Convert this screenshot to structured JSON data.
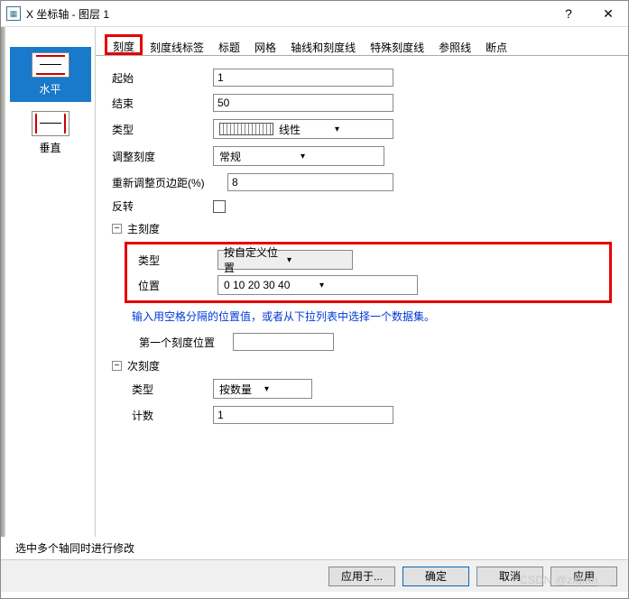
{
  "titlebar": {
    "title": "X 坐标轴 - 图层 1",
    "help": "?",
    "close": "✕"
  },
  "sidebar": {
    "items": [
      {
        "label": "水平",
        "selected": true
      },
      {
        "label": "垂直",
        "selected": false
      }
    ]
  },
  "tabs": {
    "items": [
      "刻度",
      "刻度线标签",
      "标题",
      "网格",
      "轴线和刻度线",
      "特殊刻度线",
      "参照线",
      "断点"
    ],
    "active": "刻度"
  },
  "fields": {
    "start_label": "起始",
    "start_value": "1",
    "end_label": "结束",
    "end_value": "50",
    "type_label": "类型",
    "type_value": "线性",
    "rescale_label": "调整刻度",
    "rescale_value": "常规",
    "margin_label": "重新调整页边距(%)",
    "margin_value": "8",
    "reverse_label": "反转",
    "major_group": "主刻度",
    "major_type_label": "类型",
    "major_type_value": "按自定义位置",
    "major_pos_label": "位置",
    "major_pos_value": "0 10 20 30 40",
    "info_text": "输入用空格分隔的位置值，或者从下拉列表中选择一个数据集。",
    "first_tick_label": "第一个刻度位置",
    "first_tick_value": "",
    "minor_group": "次刻度",
    "minor_type_label": "类型",
    "minor_type_value": "按数量",
    "minor_count_label": "计数",
    "minor_count_value": "1"
  },
  "footer": {
    "note": "选中多个轴同时进行修改"
  },
  "buttons": {
    "apply": "应用于...",
    "ok": "确定",
    "cancel": "取消",
    "apply2": "应用"
  },
  "watermark": "CSDN @ziqian__"
}
